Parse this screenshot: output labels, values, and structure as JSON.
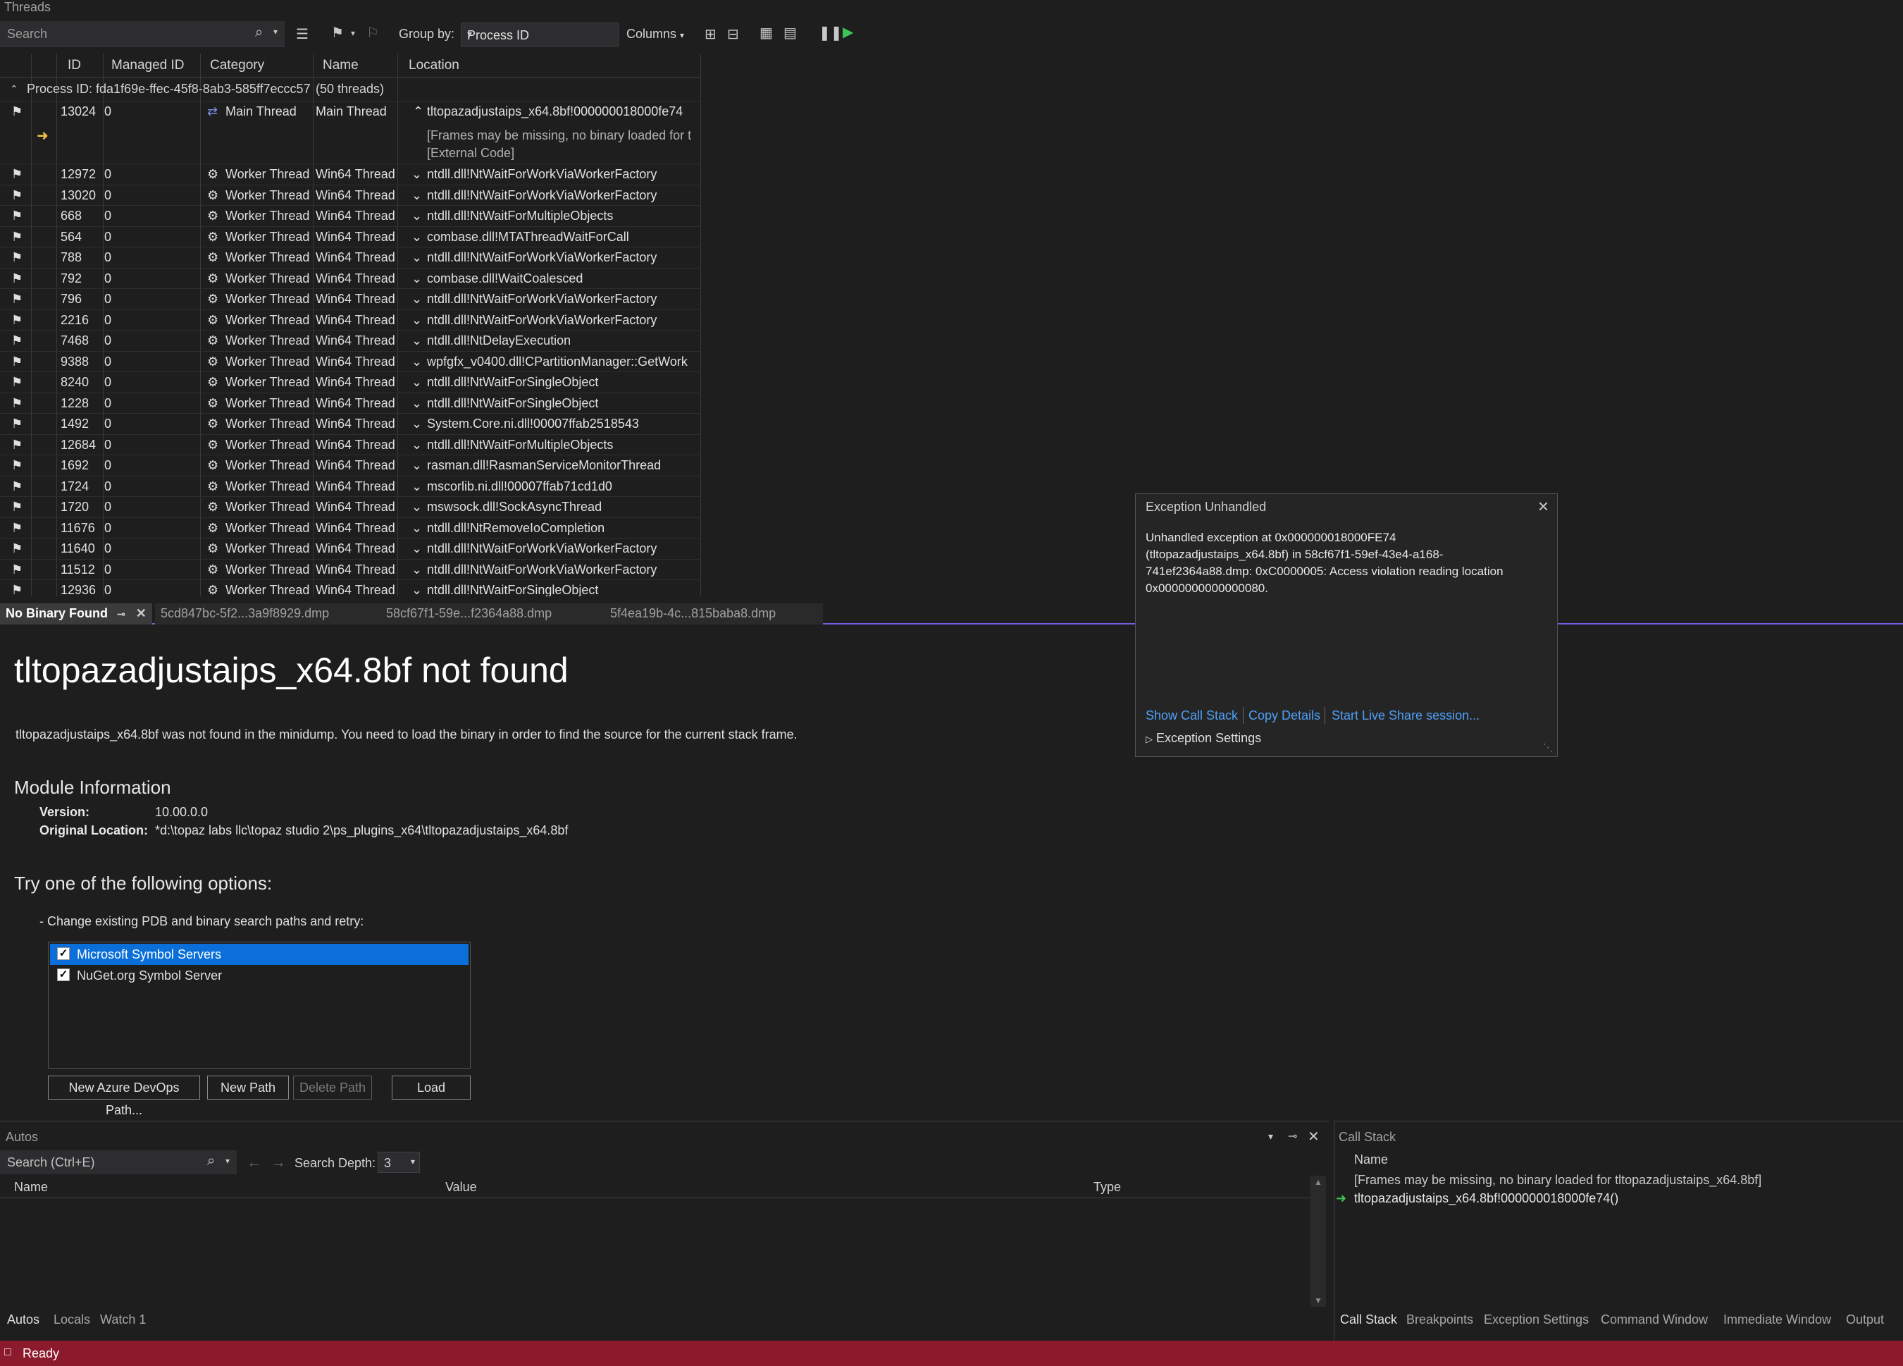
{
  "threads": {
    "title": "Threads",
    "search_placeholder": "Search",
    "groupby_label": "Group by:",
    "groupby_value": "Process ID",
    "columns_label": "Columns",
    "headers": [
      "ID",
      "Managed ID",
      "Category",
      "Name",
      "Location"
    ],
    "process_row": "Process ID: fda1f69e-ffec-45f8-8ab3-585ff7eccc57",
    "process_count": "(50 threads)",
    "main_thread": {
      "id": "13024",
      "managed_id": "0",
      "category": "Main Thread",
      "name": "Main Thread",
      "location": "tltopazadjustaips_x64.8bf!000000018000fe74",
      "frames_note": "[Frames may be missing, no binary loaded for t",
      "external": "[External Code]"
    },
    "rows": [
      {
        "id": "12972",
        "managed_id": "0",
        "category": "Worker Thread",
        "name": "Win64 Thread",
        "location": "ntdll.dll!NtWaitForWorkViaWorkerFactory"
      },
      {
        "id": "13020",
        "managed_id": "0",
        "category": "Worker Thread",
        "name": "Win64 Thread",
        "location": "ntdll.dll!NtWaitForWorkViaWorkerFactory"
      },
      {
        "id": "668",
        "managed_id": "0",
        "category": "Worker Thread",
        "name": "Win64 Thread",
        "location": "ntdll.dll!NtWaitForMultipleObjects"
      },
      {
        "id": "564",
        "managed_id": "0",
        "category": "Worker Thread",
        "name": "Win64 Thread",
        "location": "combase.dll!MTAThreadWaitForCall"
      },
      {
        "id": "788",
        "managed_id": "0",
        "category": "Worker Thread",
        "name": "Win64 Thread",
        "location": "ntdll.dll!NtWaitForWorkViaWorkerFactory"
      },
      {
        "id": "792",
        "managed_id": "0",
        "category": "Worker Thread",
        "name": "Win64 Thread",
        "location": "combase.dll!WaitCoalesced"
      },
      {
        "id": "796",
        "managed_id": "0",
        "category": "Worker Thread",
        "name": "Win64 Thread",
        "location": "ntdll.dll!NtWaitForWorkViaWorkerFactory"
      },
      {
        "id": "2216",
        "managed_id": "0",
        "category": "Worker Thread",
        "name": "Win64 Thread",
        "location": "ntdll.dll!NtWaitForWorkViaWorkerFactory"
      },
      {
        "id": "7468",
        "managed_id": "0",
        "category": "Worker Thread",
        "name": "Win64 Thread",
        "location": "ntdll.dll!NtDelayExecution"
      },
      {
        "id": "9388",
        "managed_id": "0",
        "category": "Worker Thread",
        "name": "Win64 Thread",
        "location": "wpfgfx_v0400.dll!CPartitionManager::GetWork"
      },
      {
        "id": "8240",
        "managed_id": "0",
        "category": "Worker Thread",
        "name": "Win64 Thread",
        "location": "ntdll.dll!NtWaitForSingleObject"
      },
      {
        "id": "1228",
        "managed_id": "0",
        "category": "Worker Thread",
        "name": "Win64 Thread",
        "location": "ntdll.dll!NtWaitForSingleObject"
      },
      {
        "id": "1492",
        "managed_id": "0",
        "category": "Worker Thread",
        "name": "Win64 Thread",
        "location": "System.Core.ni.dll!00007ffab2518543"
      },
      {
        "id": "12684",
        "managed_id": "0",
        "category": "Worker Thread",
        "name": "Win64 Thread",
        "location": "ntdll.dll!NtWaitForMultipleObjects"
      },
      {
        "id": "1692",
        "managed_id": "0",
        "category": "Worker Thread",
        "name": "Win64 Thread",
        "location": "rasman.dll!RasmanServiceMonitorThread"
      },
      {
        "id": "1724",
        "managed_id": "0",
        "category": "Worker Thread",
        "name": "Win64 Thread",
        "location": "mscorlib.ni.dll!00007ffab71cd1d0"
      },
      {
        "id": "1720",
        "managed_id": "0",
        "category": "Worker Thread",
        "name": "Win64 Thread",
        "location": "mswsock.dll!SockAsyncThread"
      },
      {
        "id": "11676",
        "managed_id": "0",
        "category": "Worker Thread",
        "name": "Win64 Thread",
        "location": "ntdll.dll!NtRemoveIoCompletion"
      },
      {
        "id": "11640",
        "managed_id": "0",
        "category": "Worker Thread",
        "name": "Win64 Thread",
        "location": "ntdll.dll!NtWaitForWorkViaWorkerFactory"
      },
      {
        "id": "11512",
        "managed_id": "0",
        "category": "Worker Thread",
        "name": "Win64 Thread",
        "location": "ntdll.dll!NtWaitForWorkViaWorkerFactory"
      },
      {
        "id": "12936",
        "managed_id": "0",
        "category": "Worker Thread",
        "name": "Win64 Thread",
        "location": "ntdll.dll!NtWaitForSingleObject"
      }
    ]
  },
  "tabs": {
    "active": "No Binary Found",
    "others": [
      "5cd847bc-5f2...3a9f8929.dmp",
      "58cf67f1-59e...f2364a88.dmp",
      "5f4ea19b-4c...815baba8.dmp"
    ]
  },
  "nobinary": {
    "title": "tltopazadjustaips_x64.8bf not found",
    "desc": "tltopazadjustaips_x64.8bf was not found in the minidump. You need to load the binary in order to find the source for the current stack frame.",
    "module_title": "Module Information",
    "version_label": "Version:",
    "version_value": "10.00.0.0",
    "location_label": "Original Location:",
    "location_value": "*d:\\topaz labs llc\\topaz studio 2\\ps_plugins_x64\\tltopazadjustaips_x64.8bf",
    "try_title": "Try one of the following options:",
    "option1": "-  Change existing PDB and binary search paths and retry:",
    "servers": [
      "Microsoft Symbol Servers",
      "NuGet.org Symbol Server"
    ],
    "buttons": {
      "azure": "New Azure DevOps Path...",
      "new_path": "New Path",
      "delete_path": "Delete Path",
      "load": "Load"
    }
  },
  "exception": {
    "title": "Exception Unhandled",
    "message": "Unhandled exception at 0x000000018000FE74 (tltopazadjustaips_x64.8bf) in 58cf67f1-59ef-43e4-a168-741ef2364a88.dmp: 0xC0000005: Access violation reading location 0x0000000000000080.",
    "links": [
      "Show Call Stack",
      "Copy Details",
      "Start Live Share session..."
    ],
    "settings": "Exception Settings"
  },
  "autos": {
    "title": "Autos",
    "search_placeholder": "Search (Ctrl+E)",
    "depth_label": "Search Depth:",
    "depth_value": "3",
    "headers": [
      "Name",
      "Value",
      "Type"
    ],
    "tabs": [
      "Autos",
      "Locals",
      "Watch 1"
    ]
  },
  "callstack": {
    "title": "Call Stack",
    "header": "Name",
    "rows": [
      "[Frames may be missing, no binary loaded for tltopazadjustaips_x64.8bf]",
      "tltopazadjustaips_x64.8bf!000000018000fe74()"
    ],
    "tabs": [
      "Call Stack",
      "Breakpoints",
      "Exception Settings",
      "Command Window",
      "Immediate Window",
      "Output"
    ]
  },
  "status": {
    "text": "Ready"
  },
  "colors": {
    "accent": "#7160e8",
    "status_bar": "#8b1a2c",
    "link": "#4ea0f5",
    "selection": "#0a6fd8"
  }
}
